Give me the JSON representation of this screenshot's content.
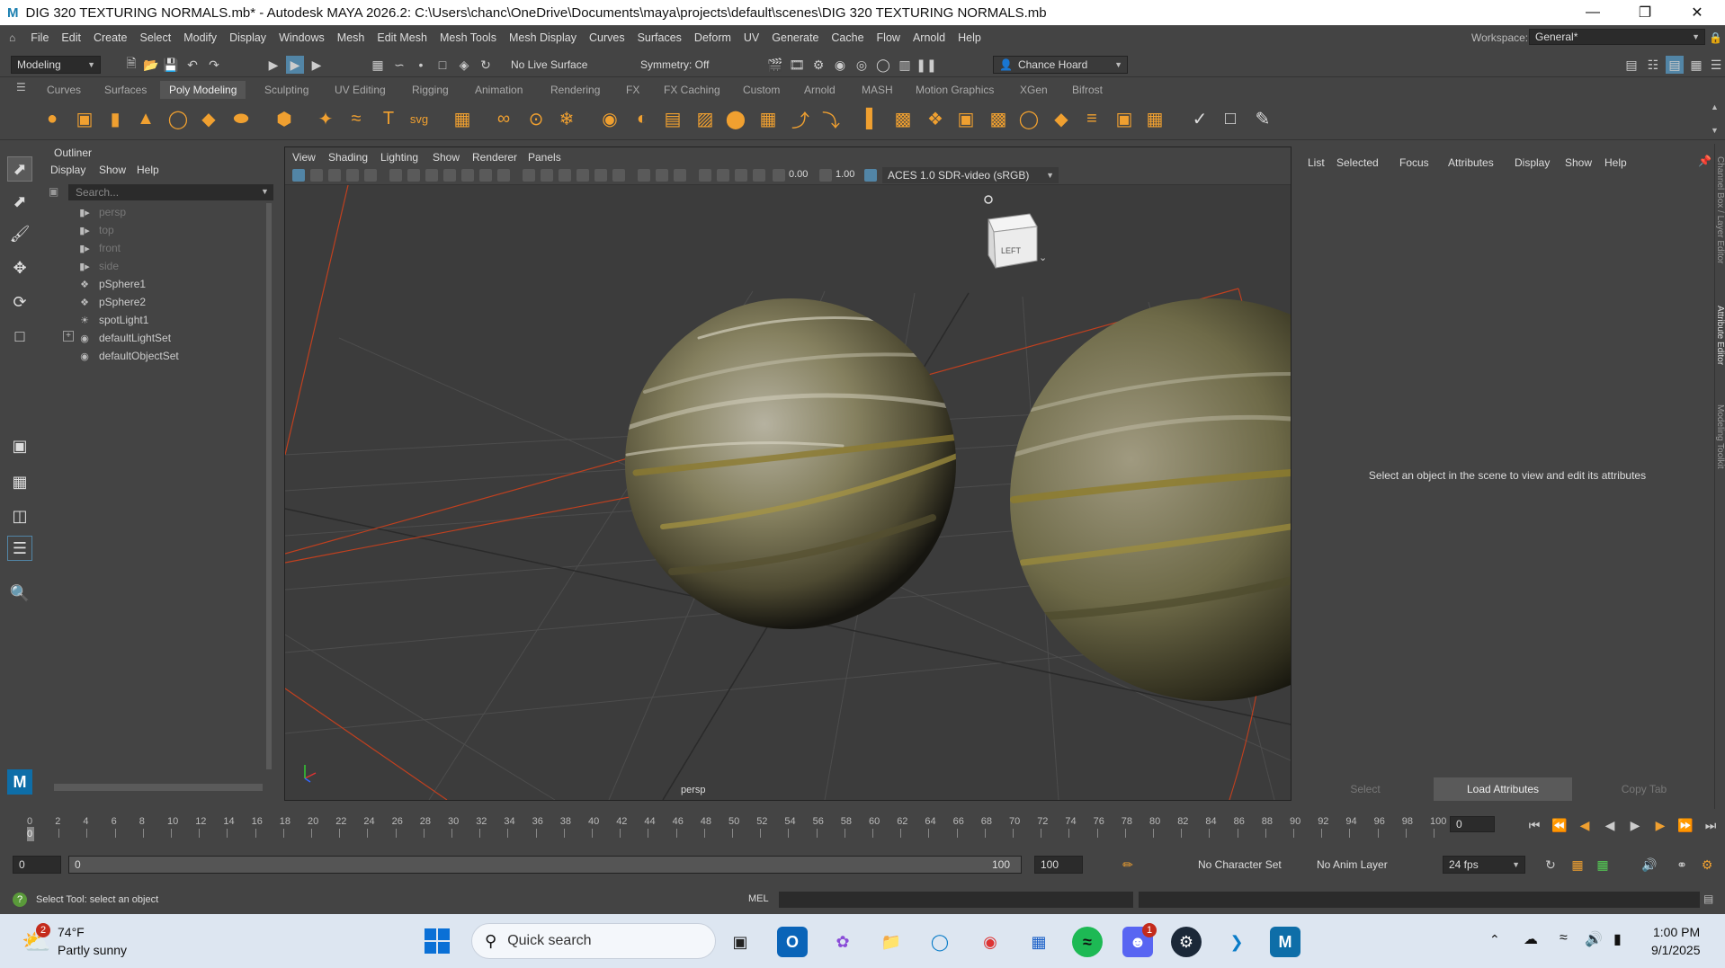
{
  "window": {
    "title": "DIG 320 TEXTURING NORMALS.mb* - Autodesk MAYA 2026.2: C:\\Users\\chanc\\OneDrive\\Documents\\maya\\projects\\default\\scenes\\DIG 320 TEXTURING NORMALS.mb"
  },
  "menus": [
    "File",
    "Edit",
    "Create",
    "Select",
    "Modify",
    "Display",
    "Windows",
    "Mesh",
    "Edit Mesh",
    "Mesh Tools",
    "Mesh Display",
    "Curves",
    "Surfaces",
    "Deform",
    "UV",
    "Generate",
    "Cache",
    "Flow",
    "Arnold",
    "Help"
  ],
  "status": {
    "mode": "Modeling",
    "live_surface": "No Live Surface",
    "symmetry": "Symmetry: Off",
    "user": "Chance Hoard",
    "workspace_label": "Workspace:",
    "workspace": "General*"
  },
  "shelf_tabs": [
    "Curves",
    "Surfaces",
    "Poly Modeling",
    "Sculpting",
    "UV Editing",
    "Rigging",
    "Animation",
    "Rendering",
    "FX",
    "FX Caching",
    "Custom",
    "Arnold",
    "MASH",
    "Motion Graphics",
    "XGen",
    "Bifrost"
  ],
  "outliner": {
    "title": "Outliner",
    "menu": [
      "Display",
      "Show",
      "Help"
    ],
    "search_placeholder": "Search...",
    "items": [
      {
        "label": "persp",
        "icon": "camera-icon",
        "dim": true
      },
      {
        "label": "top",
        "icon": "camera-icon",
        "dim": true
      },
      {
        "label": "front",
        "icon": "camera-icon",
        "dim": true
      },
      {
        "label": "side",
        "icon": "camera-icon",
        "dim": true
      },
      {
        "label": "pSphere1",
        "icon": "mesh-icon",
        "dim": false
      },
      {
        "label": "pSphere2",
        "icon": "mesh-icon",
        "dim": false
      },
      {
        "label": "spotLight1",
        "icon": "light-icon",
        "dim": false
      },
      {
        "label": "defaultLightSet",
        "icon": "set-icon",
        "dim": false
      },
      {
        "label": "defaultObjectSet",
        "icon": "set-icon",
        "dim": false
      }
    ]
  },
  "viewport": {
    "menu": [
      "View",
      "Shading",
      "Lighting",
      "Show",
      "Renderer",
      "Panels"
    ],
    "exposure": "0.00",
    "gamma": "1.00",
    "colorspace": "ACES 1.0 SDR-video (sRGB)",
    "camera": "persp",
    "viewcube": "LEFT"
  },
  "attribute_editor": {
    "menu": [
      "List",
      "Selected",
      "Focus",
      "Attributes",
      "Display",
      "Show",
      "Help"
    ],
    "message": "Select an object in the scene to view and edit its attributes",
    "buttons": [
      "Select",
      "Load Attributes",
      "Copy Tab"
    ]
  },
  "side_tabs": [
    "Channel Box / Layer Editor",
    "Attribute Editor",
    "Modeling Toolkit"
  ],
  "timeline": {
    "ticks": [
      "0",
      "2",
      "4",
      "6",
      "8",
      "10",
      "12",
      "14",
      "16",
      "18",
      "20",
      "22",
      "24",
      "26",
      "28",
      "30",
      "32",
      "34",
      "36",
      "38",
      "40",
      "42",
      "44",
      "46",
      "48",
      "50",
      "52",
      "54",
      "56",
      "58",
      "60",
      "62",
      "64",
      "66",
      "68",
      "70",
      "72",
      "74",
      "76",
      "78",
      "80",
      "82",
      "84",
      "86",
      "88",
      "90",
      "92",
      "94",
      "96",
      "98",
      "100"
    ],
    "current": "0",
    "frame_field": "0"
  },
  "range": {
    "start": "0",
    "inner_start": "0",
    "inner_end": "100",
    "end": "100",
    "character_set": "No Character Set",
    "anim_layer": "No Anim Layer",
    "fps": "24 fps"
  },
  "command": {
    "help": "Select Tool: select an object",
    "lang": "MEL"
  },
  "taskbar": {
    "temp": "74°F",
    "weather": "Partly sunny",
    "badge": "2",
    "search": "Quick search",
    "time": "1:00 PM",
    "date": "9/1/2025",
    "discord_badge": "1"
  }
}
